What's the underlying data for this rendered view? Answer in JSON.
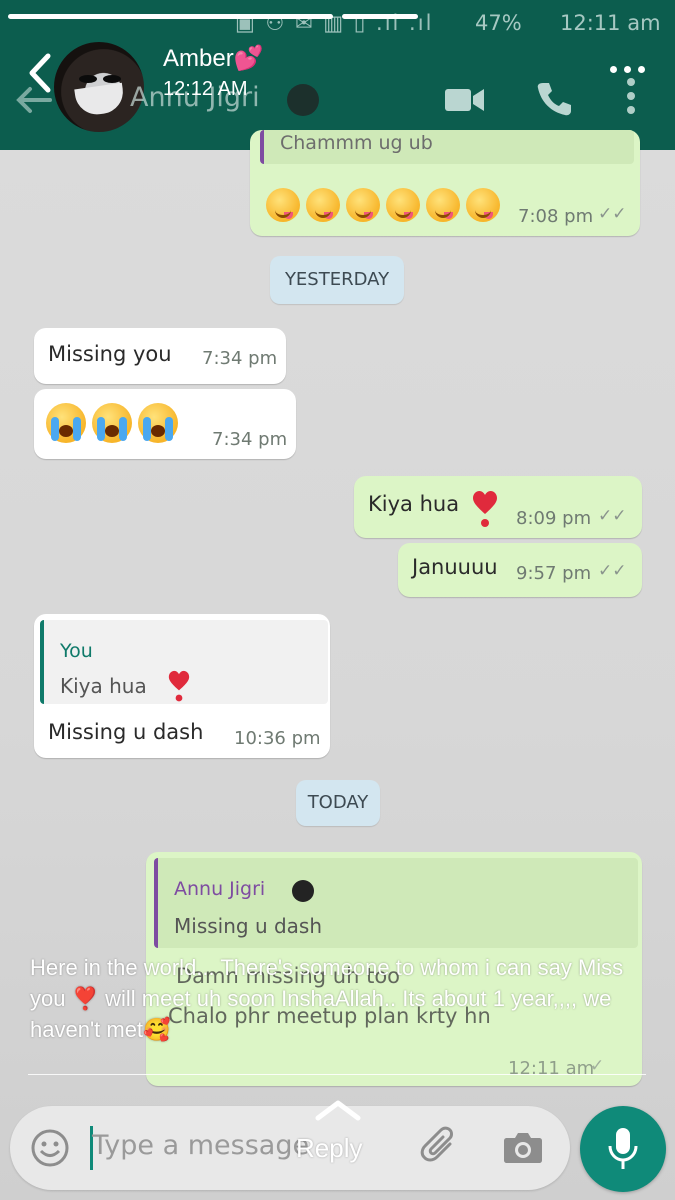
{
  "story": {
    "user_name": "Amber💕",
    "time": "12:12 AM",
    "caption": "Here in the world... There's someone to whom i can say Miss you ❣️ will meet uh soon InshaAllah.. Its about 1 year,,,, we haven't met🥰",
    "reply_label": "Reply"
  },
  "statusbar": {
    "battery": "47%",
    "time": "12:11 am"
  },
  "chat": {
    "contact_name": "Annu Jigri",
    "contact_emoji": "🌚",
    "messages": [
      {
        "dir": "out",
        "text": "Chammm ug ub",
        "time": "7:08 pm"
      },
      {
        "dir": "date",
        "text": "YESTERDAY"
      },
      {
        "dir": "in",
        "text": "Missing you",
        "time": "7:34 pm"
      },
      {
        "dir": "in",
        "text": "😭😭😭",
        "time": "7:34 pm"
      },
      {
        "dir": "out",
        "text": "Kiya hua",
        "time": "8:09 pm"
      },
      {
        "dir": "out",
        "text": "Januuuu",
        "time": "9:57 pm"
      },
      {
        "dir": "in",
        "reply_author": "You",
        "reply_text": "Kiya hua",
        "text": "Missing u dash",
        "time": "10:36 pm"
      },
      {
        "dir": "date",
        "text": "TODAY"
      },
      {
        "dir": "out",
        "reply_author": "Annu Jigri",
        "reply_text": "Missing u dash",
        "text": "Damn missing uh too",
        "text2": "Chalo phr meetup plan krty hn",
        "time": "12:11 am"
      }
    ]
  },
  "composer": {
    "placeholder": "Type a message"
  },
  "icons": {
    "back": "chevron-left-icon",
    "menu": "more-vertical-icon",
    "video": "video-call-icon",
    "call": "phone-icon",
    "emoji": "smiley-icon",
    "attach": "paperclip-icon",
    "camera": "camera-icon",
    "mic": "mic-icon"
  },
  "colors": {
    "header": "#0c5d4e",
    "outgoing_bubble": "#dcf5c6",
    "incoming_bubble": "#ffffff",
    "date_chip": "#d3e6f0",
    "mic_button": "#0f8a79"
  }
}
